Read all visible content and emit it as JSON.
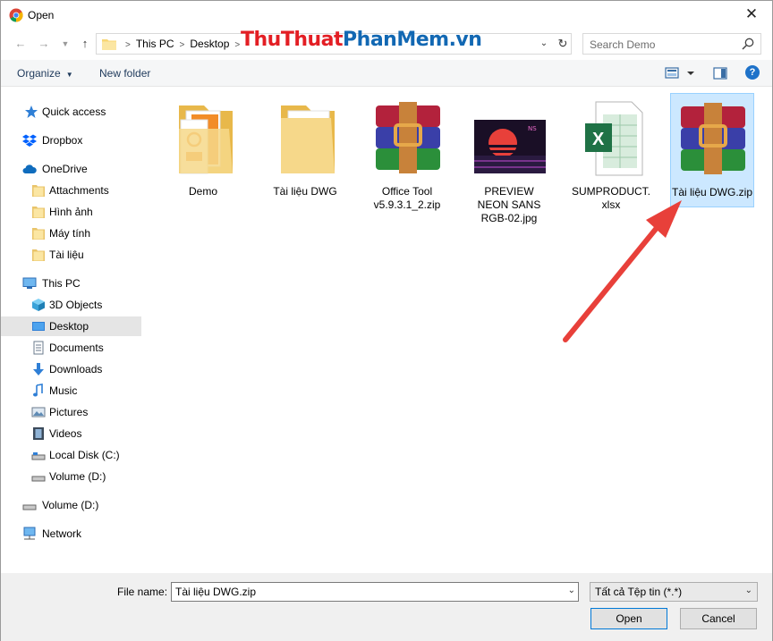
{
  "window": {
    "title": "Open",
    "close_glyph": "✕"
  },
  "address": {
    "breadcrumbs": [
      "This PC",
      "Desktop"
    ],
    "search_placeholder": "Search Demo"
  },
  "watermark": {
    "part1": "Thu",
    "part2": "Thuat",
    "part3": "PhanMem",
    "part4": ".vn",
    "colors": {
      "thu": "#e31e24",
      "thuat": "#e31e24",
      "phanmem": "#1268b3",
      "vn": "#1268b3"
    }
  },
  "toolbar": {
    "organize_label": "Organize",
    "new_folder_label": "New folder",
    "help_label": "?"
  },
  "sidebar": {
    "items": [
      {
        "label": "Quick access",
        "icon": "star-icon"
      },
      {
        "label": "Dropbox",
        "icon": "dropbox-icon"
      },
      {
        "label": "OneDrive",
        "icon": "cloud-icon"
      },
      {
        "label": "Attachments",
        "icon": "folder-icon"
      },
      {
        "label": "Hình ảnh",
        "icon": "folder-icon"
      },
      {
        "label": "Máy tính",
        "icon": "folder-icon"
      },
      {
        "label": "Tài liệu",
        "icon": "folder-icon"
      },
      {
        "label": "This PC",
        "icon": "pc-icon"
      },
      {
        "label": "3D Objects",
        "icon": "cube-icon"
      },
      {
        "label": "Desktop",
        "icon": "desktop-icon",
        "selected": true
      },
      {
        "label": "Documents",
        "icon": "documents-icon"
      },
      {
        "label": "Downloads",
        "icon": "download-icon"
      },
      {
        "label": "Music",
        "icon": "music-icon"
      },
      {
        "label": "Pictures",
        "icon": "pictures-icon"
      },
      {
        "label": "Videos",
        "icon": "videos-icon"
      },
      {
        "label": "Local Disk (C:)",
        "icon": "drive-icon"
      },
      {
        "label": "Volume (D:)",
        "icon": "drive-icon"
      },
      {
        "label": "Volume (D:)",
        "icon": "drive-icon"
      },
      {
        "label": "Network",
        "icon": "network-icon"
      }
    ]
  },
  "files": [
    {
      "name": "Demo",
      "type": "folder-pdf"
    },
    {
      "name": "Tài liệu DWG",
      "type": "folder"
    },
    {
      "name": "Office Tool v5.9.3.1_2.zip",
      "type": "archive"
    },
    {
      "name": "PREVIEW NEON SANS RGB-02.jpg",
      "type": "image"
    },
    {
      "name": "SUMPRODUCT.xlsx",
      "type": "excel"
    },
    {
      "name": "Tài liệu DWG.zip",
      "type": "archive",
      "selected": true
    }
  ],
  "bottom": {
    "file_name_label": "File name:",
    "file_name_value": "Tài liệu DWG.zip",
    "file_type_value": "Tất cả Tệp tin (*.*)",
    "open_label": "Open",
    "cancel_label": "Cancel"
  },
  "colors": {
    "accent": "#0078d7",
    "selection": "#cce8ff",
    "arrow": "#e8403a"
  }
}
